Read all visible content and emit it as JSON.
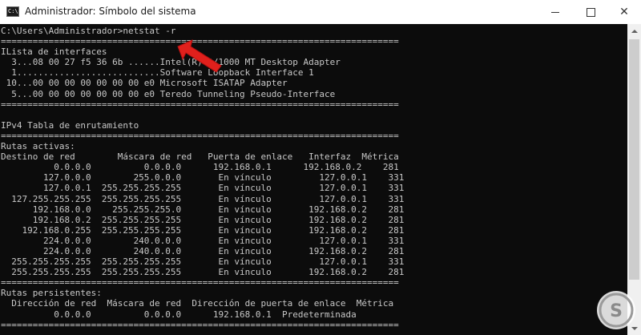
{
  "window": {
    "title": "Administrador: Símbolo del sistema",
    "app_icon_text": "C:\\",
    "controls": {
      "minimize": "minimize-icon",
      "maximize": "maximize-icon",
      "close": "close-icon",
      "close_glyph": "✕"
    }
  },
  "console": {
    "lines": [
      "C:\\Users\\Administrador>netstat -r",
      "===========================================================================",
      "ILista de interfaces",
      "  3...08 00 27 f5 36 6b ......Intel(R) 1/1000 MT Desktop Adapter",
      "  1...........................Software Loopback Interface 1",
      " 10...00 00 00 00 00 00 00 e0 Microsoft ISATAP Adapter",
      "  5...00 00 00 00 00 00 00 e0 Teredo Tunneling Pseudo-Interface",
      "===========================================================================",
      "",
      "IPv4 Tabla de enrutamiento",
      "===========================================================================",
      "Rutas activas:",
      "Destino de red        Máscara de red   Puerta de enlace   Interfaz  Métrica",
      "          0.0.0.0          0.0.0.0      192.168.0.1      192.168.0.2    281",
      "        127.0.0.0        255.0.0.0       En vínculo         127.0.0.1    331",
      "        127.0.0.1  255.255.255.255       En vínculo         127.0.0.1    331",
      "  127.255.255.255  255.255.255.255       En vínculo         127.0.0.1    331",
      "      192.168.0.0    255.255.255.0       En vínculo       192.168.0.2    281",
      "      192.168.0.2  255.255.255.255       En vínculo       192.168.0.2    281",
      "    192.168.0.255  255.255.255.255       En vínculo       192.168.0.2    281",
      "        224.0.0.0        240.0.0.0       En vínculo         127.0.0.1    331",
      "        224.0.0.0        240.0.0.0       En vínculo       192.168.0.2    281",
      "  255.255.255.255  255.255.255.255       En vínculo         127.0.0.1    331",
      "  255.255.255.255  255.255.255.255       En vínculo       192.168.0.2    281",
      "===========================================================================",
      "Rutas persistentes:",
      "  Dirección de red  Máscara de red  Dirección de puerta de enlace  Métrica",
      "          0.0.0.0          0.0.0.0      192.168.0.1  Predeterminada",
      "==========================================================================="
    ]
  },
  "colors": {
    "console_bg": "#0c0c0c",
    "console_text": "#c8c8c8",
    "arrow": "#e0201c",
    "titlebar_bg": "#ffffff"
  },
  "annotation": {
    "arrow_icon": "red-arrow-icon"
  },
  "watermark": {
    "text": "S",
    "icon": "logo-icon"
  }
}
